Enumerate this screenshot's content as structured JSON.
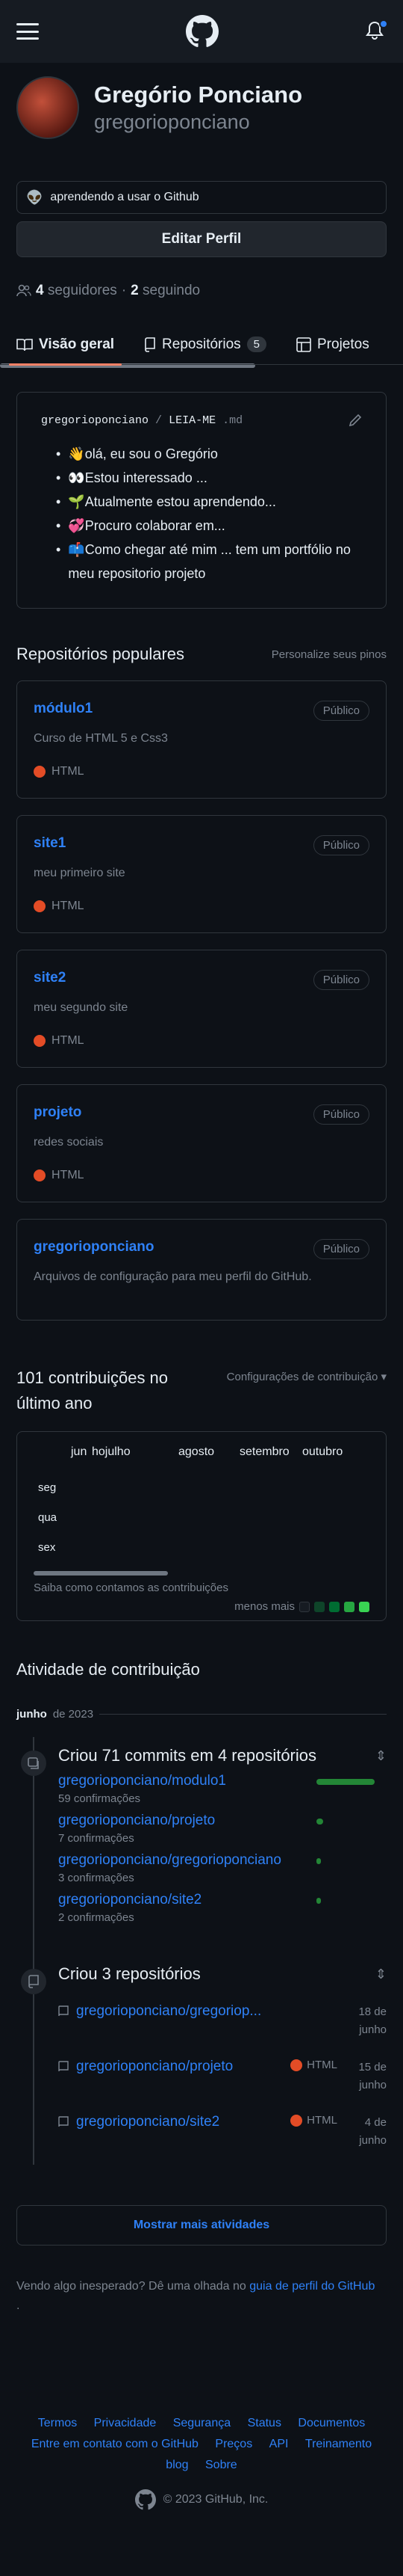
{
  "profile": {
    "full_name": "Gregório Ponciano",
    "login": "gregorioponciano",
    "status_emoji": "👽",
    "status_text": "aprendendo a usar o Github",
    "edit_label": "Editar Perfil",
    "followers_count": "4",
    "followers_label": "seguidores",
    "following_count": "2",
    "following_label": "seguindo"
  },
  "tabs": [
    {
      "label": "Visão geral"
    },
    {
      "label": "Repositórios",
      "count": "5"
    },
    {
      "label": "Projetos"
    }
  ],
  "readme": {
    "owner": "gregorioponciano",
    "separator": "/",
    "file": "LEIA-ME",
    "ext": ".md",
    "items": [
      {
        "emoji": "👋",
        "text": "olá, eu sou o Gregório"
      },
      {
        "emoji": "👀",
        "text": "Estou interessado ..."
      },
      {
        "emoji": "🌱",
        "text": "Atualmente estou aprendendo..."
      },
      {
        "emoji": "💞️",
        "text": "Procuro colaborar em..."
      },
      {
        "emoji": "📫",
        "text": "Como chegar até mim ... tem um portfólio no meu repositorio projeto"
      }
    ]
  },
  "popular": {
    "title": "Repositórios populares",
    "customize": "Personalize seus pinos",
    "repos": [
      {
        "name": "módulo1",
        "badge": "Público",
        "desc": "Curso de HTML 5 e Css3",
        "lang": "HTML"
      },
      {
        "name": "site1",
        "badge": "Público",
        "desc": "meu primeiro site",
        "lang": "HTML"
      },
      {
        "name": "site2",
        "badge": "Público",
        "desc": "meu segundo site",
        "lang": "HTML"
      },
      {
        "name": "projeto",
        "badge": "Público",
        "desc": "redes sociais",
        "lang": "HTML"
      },
      {
        "name": "gregorioponciano",
        "badge": "Público",
        "desc": "Arquivos de configuração para meu perfil do GitHub.",
        "lang": ""
      }
    ],
    "lang_color": "#e34c26"
  },
  "contributions": {
    "title": "101 contribuições no último ano",
    "settings": "Configurações de contribuição",
    "months": [
      "jun",
      "hojulho",
      "agosto",
      "setembro",
      "outubro"
    ],
    "days": [
      "seg",
      "qua",
      "sex"
    ],
    "learn": "Saiba como contamos as contribuições",
    "less_more": "menos mais",
    "scale_colors": [
      "#161b22",
      "#0e4429",
      "#006d32",
      "#26a641",
      "#39d353"
    ]
  },
  "activity": {
    "title": "Atividade de contribuição",
    "month": "junho",
    "year": "de 2023",
    "commits": {
      "title": "Criou 71 commits em 4 repositórios",
      "rows": [
        {
          "repo": "gregorioponciano/modulo1",
          "count": "59 confirmações",
          "share": 0.83
        },
        {
          "repo": "gregorioponciano/projeto",
          "count": "7 confirmações",
          "share": 0.1
        },
        {
          "repo": "gregorioponciano/gregorioponciano",
          "count": "3 confirmações",
          "share": 0.04
        },
        {
          "repo": "gregorioponciano/site2",
          "count": "2 confirmações",
          "share": 0.03
        }
      ]
    },
    "created": {
      "title": "Criou 3 repositórios",
      "rows": [
        {
          "repo": "gregorioponciano/gregoriop...",
          "lang": "",
          "date": "18 de junho"
        },
        {
          "repo": "gregorioponciano/projeto",
          "lang": "HTML",
          "date": "15 de junho"
        },
        {
          "repo": "gregorioponciano/site2",
          "lang": "HTML",
          "date": "4 de junho"
        }
      ]
    },
    "more": "Mostrar mais atividades",
    "unexpected_prefix": "Vendo algo inesperado? Dê uma olhada no",
    "unexpected_link": "guia de perfil do GitHub",
    "unexpected_suffix": "."
  },
  "footer": {
    "links": [
      "Termos",
      "Privacidade",
      "Segurança",
      "Status",
      "Documentos",
      "Entre em contato com o GitHub",
      "Preços",
      "API",
      "Treinamento",
      "blog",
      "Sobre"
    ],
    "copyright": "© 2023 GitHub, Inc."
  }
}
